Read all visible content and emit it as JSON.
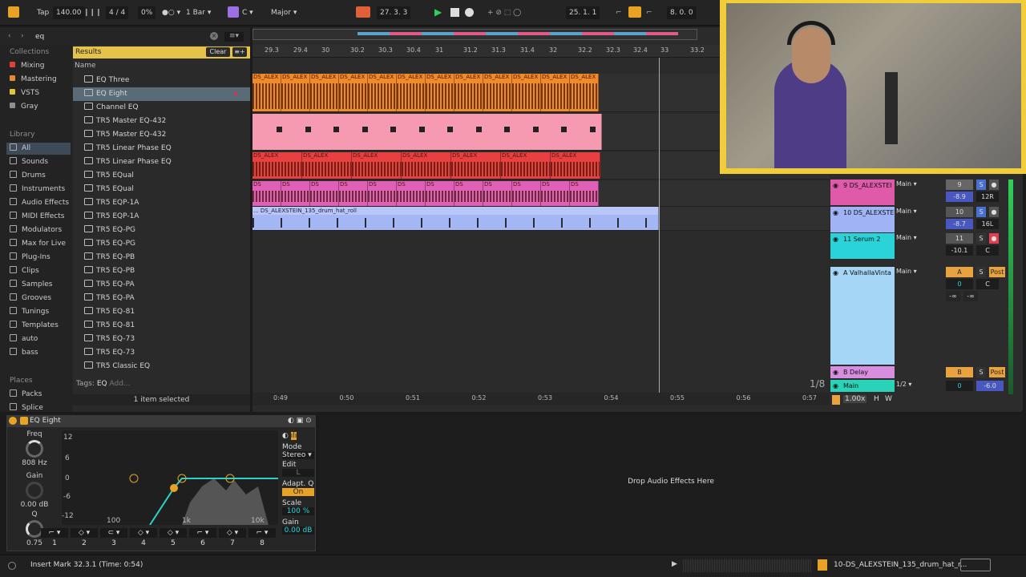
{
  "topbar": {
    "tap": "Tap",
    "tempo": "140.00",
    "sig": "4 / 4",
    "swing": "0%",
    "quant": "1 Bar",
    "key": "C",
    "scale": "Major",
    "position": "27.  3.  3",
    "loop_start": "25.  1.  1",
    "loop_len": "8.  0.  0"
  },
  "browser": {
    "search": "eq",
    "collections_title": "Collections",
    "collections": [
      {
        "label": "Mixing",
        "color": "#e0403a"
      },
      {
        "label": "Mastering",
        "color": "#e88a2a"
      },
      {
        "label": "VSTS",
        "color": "#e0c630"
      },
      {
        "label": "Gray",
        "color": "#8f8f8f"
      }
    ],
    "library_title": "Library",
    "library": [
      "All",
      "Sounds",
      "Drums",
      "Instruments",
      "Audio Effects",
      "MIDI Effects",
      "Modulators",
      "Max for Live",
      "Plug-Ins",
      "Clips",
      "Samples",
      "Grooves",
      "Tunings",
      "Templates",
      "auto",
      "bass"
    ],
    "places_title": "Places",
    "places": [
      "Packs",
      "Splice"
    ],
    "results_title": "Results",
    "clear": "Clear",
    "name_col": "Name",
    "results": [
      "EQ Three",
      "EQ Eight",
      "Channel EQ",
      "TR5 Master EQ-432",
      "TR5 Master EQ-432",
      "TR5 Linear Phase EQ",
      "TR5 Linear Phase EQ",
      "TR5 EQual",
      "TR5 EQual",
      "TR5 EQP-1A",
      "TR5 EQP-1A",
      "TR5 EQ-PG",
      "TR5 EQ-PG",
      "TR5 EQ-PB",
      "TR5 EQ-PB",
      "TR5 EQ-PA",
      "TR5 EQ-PA",
      "TR5 EQ-81",
      "TR5 EQ-81",
      "TR5 EQ-73",
      "TR5 EQ-73",
      "TR5 Classic EQ"
    ],
    "tags_label": "Tags:",
    "tag": "EQ",
    "add": "Add...",
    "status": "1 item selected"
  },
  "ruler": [
    "29.3",
    "29.4",
    "30",
    "30.2",
    "30.3",
    "30.4",
    "31",
    "31.2",
    "31.3",
    "31.4",
    "32",
    "32.2",
    "32.3",
    "32.4",
    "33",
    "33.2"
  ],
  "clip_label": "DS_ALEX",
  "drum_clip_label": "DS",
  "hatroll_label": "... DS_ALEXSTEIN_135_drum_hat_roll",
  "timeaxis": [
    "0:49",
    "0:50",
    "0:51",
    "0:52",
    "0:53",
    "0:54",
    "0:55",
    "0:56",
    "0:57"
  ],
  "mixer": {
    "tracks": [
      {
        "name": "9 DS_ALEXSTEI",
        "color": "#e05aaa",
        "route": "Main",
        "num": "9",
        "vol": "-8.9",
        "pan": "12R"
      },
      {
        "name": "10 DS_ALEXSTE",
        "color": "#9fb3f5",
        "route": "Main",
        "num": "10",
        "vol": "-8.7",
        "pan": "16L"
      },
      {
        "name": "11 Serum 2",
        "color": "#2ad3d8",
        "route": "Main",
        "num": "11",
        "vol": "-10.1",
        "pan": "C"
      },
      {
        "name": "A ValhallaVinta",
        "color": "#a5d6f5",
        "route": "Main",
        "num": "A",
        "vol": "0",
        "pan": "C",
        "post": "Post",
        "inf1": "-∞",
        "inf2": "-∞"
      },
      {
        "name": "B Delay",
        "color": "#d88ee0",
        "route": "",
        "num": "B",
        "post": "Post"
      },
      {
        "name": "Main",
        "color": "#2ad3b8",
        "route": "1/2",
        "num": "0",
        "vol": "-6.0"
      }
    ],
    "solo": "S",
    "zoom_frac": "1/8",
    "zoom_pct": "1.00x",
    "h": "H",
    "w": "W"
  },
  "device": {
    "title": "EQ Eight",
    "freq_label": "Freq",
    "freq_val": "808 Hz",
    "gain_label": "Gain",
    "gain_val": "0.00 dB",
    "q_label": "Q",
    "q_val": "0.75",
    "y_ticks": [
      "12",
      "6",
      "0",
      "-6",
      "-12"
    ],
    "x_ticks": [
      "100",
      "1k",
      "10k"
    ],
    "mode_label": "Mode",
    "mode_val": "Stereo",
    "edit_label": "Edit",
    "edit_val": "L",
    "adaptq_label": "Adapt. Q",
    "adaptq_val": "On",
    "scale_label": "Scale",
    "scale_val": "100 %",
    "gainr_label": "Gain",
    "gainr_val": "0.00 dB",
    "bands": [
      "1",
      "2",
      "3",
      "4",
      "5",
      "6",
      "7",
      "8"
    ]
  },
  "drop_text": "Drop Audio Effects Here",
  "status": {
    "text": "Insert Mark 32.3.1 (Time: 0:54)",
    "clip_name": "10-DS_ALEXSTEIN_135_drum_hat_r..."
  }
}
